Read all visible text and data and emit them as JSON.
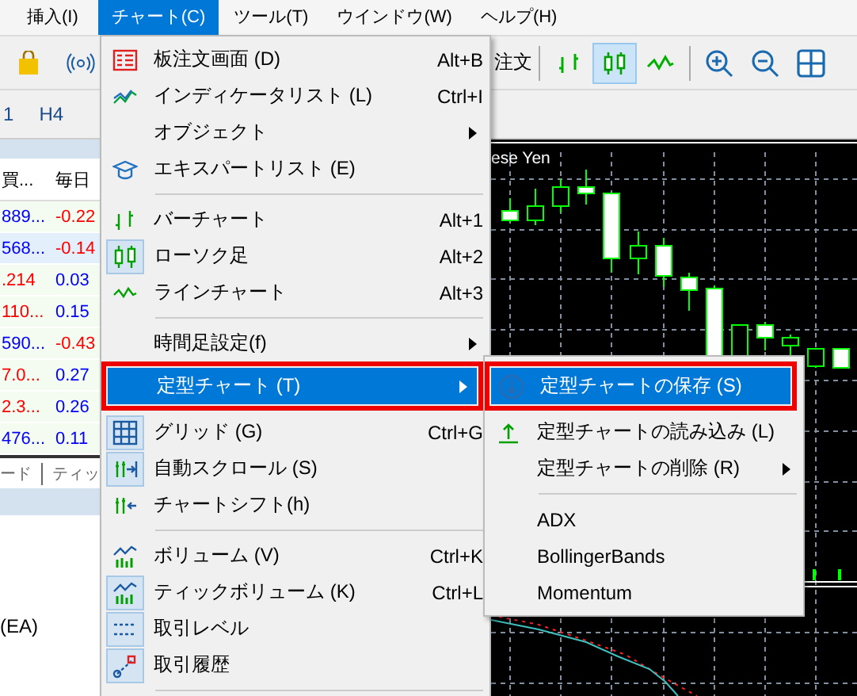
{
  "menubar": [
    {
      "label": "挿入(I)",
      "selected": false
    },
    {
      "label": "チャート(C)",
      "selected": true
    },
    {
      "label": "ツール(T)",
      "selected": false
    },
    {
      "label": "ウインドウ(W)",
      "selected": false
    },
    {
      "label": "ヘルプ(H)",
      "selected": false
    }
  ],
  "toolbar": {
    "order_label": "注文",
    "buttons": [
      {
        "selected": false
      },
      {
        "selected": true
      },
      {
        "selected": false
      },
      {
        "selected": false
      },
      {
        "selected": false
      },
      {
        "selected": false
      }
    ]
  },
  "timeframes": [
    "1",
    "H4"
  ],
  "market_watch": {
    "columns": [
      "買...",
      "毎日"
    ],
    "rows": [
      {
        "selected": false,
        "cells": [
          {
            "text": "889...",
            "color": "#0000ff"
          },
          {
            "text": "-0.22",
            "color": "#ff0000"
          }
        ]
      },
      {
        "selected": true,
        "cells": [
          {
            "text": "568...",
            "color": "#0000ff"
          },
          {
            "text": "-0.14",
            "color": "#ff0000"
          }
        ]
      },
      {
        "selected": false,
        "cells": [
          {
            "text": ".214",
            "color": "#ff0000"
          },
          {
            "text": "0.03",
            "color": "#0000ff"
          }
        ]
      },
      {
        "selected": false,
        "cells": [
          {
            "text": "110...",
            "color": "#ff0000"
          },
          {
            "text": "0.15",
            "color": "#0000ff"
          }
        ]
      },
      {
        "selected": false,
        "cells": [
          {
            "text": "590...",
            "color": "#0000ff"
          },
          {
            "text": "-0.43",
            "color": "#ff0000"
          }
        ]
      },
      {
        "selected": false,
        "cells": [
          {
            "text": "7.0...",
            "color": "#ff0000"
          },
          {
            "text": "0.27",
            "color": "#0000ff"
          }
        ]
      },
      {
        "selected": false,
        "cells": [
          {
            "text": "2.3...",
            "color": "#ff0000"
          },
          {
            "text": "0.26",
            "color": "#0000ff"
          }
        ]
      },
      {
        "selected": false,
        "cells": [
          {
            "text": "476...",
            "color": "#0000ff"
          },
          {
            "text": "0.11",
            "color": "#0000ff"
          }
        ]
      }
    ],
    "tabs": [
      "ード",
      "ティッ"
    ]
  },
  "navigator": {
    "item": "(EA)"
  },
  "chart": {
    "title": "ese Yen"
  },
  "chart_menu": [
    {
      "kind": "item",
      "label": "板注文画面 (D)",
      "shortcut": "Alt+B",
      "checked": false,
      "selected": false,
      "outlined": false,
      "submenu_arrow": false
    },
    {
      "kind": "item",
      "label": "インディケータリスト (L)",
      "shortcut": "Ctrl+I",
      "checked": false,
      "selected": false,
      "outlined": false,
      "submenu_arrow": false
    },
    {
      "kind": "item",
      "label": "オブジェクト",
      "checked": false,
      "selected": false,
      "outlined": false,
      "submenu_arrow": true
    },
    {
      "kind": "item",
      "label": "エキスパートリスト (E)",
      "checked": false,
      "selected": false,
      "outlined": false,
      "submenu_arrow": false
    },
    {
      "kind": "separator"
    },
    {
      "kind": "item",
      "label": "バーチャート",
      "shortcut": "Alt+1",
      "checked": false,
      "selected": false,
      "outlined": false,
      "submenu_arrow": false
    },
    {
      "kind": "item",
      "label": "ローソク足",
      "shortcut": "Alt+2",
      "checked": true,
      "selected": false,
      "outlined": false,
      "submenu_arrow": false
    },
    {
      "kind": "item",
      "label": "ラインチャート",
      "shortcut": "Alt+3",
      "checked": false,
      "selected": false,
      "outlined": false,
      "submenu_arrow": false
    },
    {
      "kind": "separator"
    },
    {
      "kind": "item",
      "label": "時間足設定(f)",
      "checked": false,
      "selected": false,
      "outlined": false,
      "submenu_arrow": true
    },
    {
      "kind": "item",
      "label": "定型チャート (T)",
      "checked": false,
      "selected": true,
      "outlined": true,
      "submenu_arrow": true
    },
    {
      "kind": "item",
      "label": "グリッド (G)",
      "shortcut": "Ctrl+G",
      "checked": true,
      "selected": false,
      "outlined": false,
      "submenu_arrow": false
    },
    {
      "kind": "item",
      "label": "自動スクロール (S)",
      "checked": true,
      "selected": false,
      "outlined": false,
      "submenu_arrow": false
    },
    {
      "kind": "item",
      "label": "チャートシフト(h)",
      "checked": false,
      "selected": false,
      "outlined": false,
      "submenu_arrow": false
    },
    {
      "kind": "separator"
    },
    {
      "kind": "item",
      "label": "ボリューム (V)",
      "shortcut": "Ctrl+K",
      "checked": false,
      "selected": false,
      "outlined": false,
      "submenu_arrow": false
    },
    {
      "kind": "item",
      "label": "ティックボリューム (K)",
      "shortcut": "Ctrl+L",
      "checked": true,
      "selected": false,
      "outlined": false,
      "submenu_arrow": false
    },
    {
      "kind": "item",
      "label": "取引レベル",
      "checked": true,
      "selected": false,
      "outlined": false,
      "submenu_arrow": false
    },
    {
      "kind": "item",
      "label": "取引履歴",
      "checked": true,
      "selected": false,
      "outlined": false,
      "submenu_arrow": false
    },
    {
      "kind": "separator"
    }
  ],
  "template_submenu": [
    {
      "kind": "item",
      "label": "定型チャートの保存 (S)",
      "selected": true,
      "outlined": true,
      "submenu_arrow": false
    },
    {
      "kind": "item",
      "label": "定型チャートの読み込み (L)",
      "selected": false,
      "outlined": false,
      "submenu_arrow": false
    },
    {
      "kind": "item",
      "label": "定型チャートの削除 (R)",
      "selected": false,
      "outlined": false,
      "submenu_arrow": true
    },
    {
      "kind": "separator"
    },
    {
      "kind": "item",
      "label": "ADX",
      "selected": false,
      "outlined": false,
      "submenu_arrow": false
    },
    {
      "kind": "item",
      "label": "BollingerBands",
      "selected": false,
      "outlined": false,
      "submenu_arrow": false
    },
    {
      "kind": "item",
      "label": "Momentum",
      "selected": false,
      "outlined": false,
      "submenu_arrow": false
    }
  ]
}
